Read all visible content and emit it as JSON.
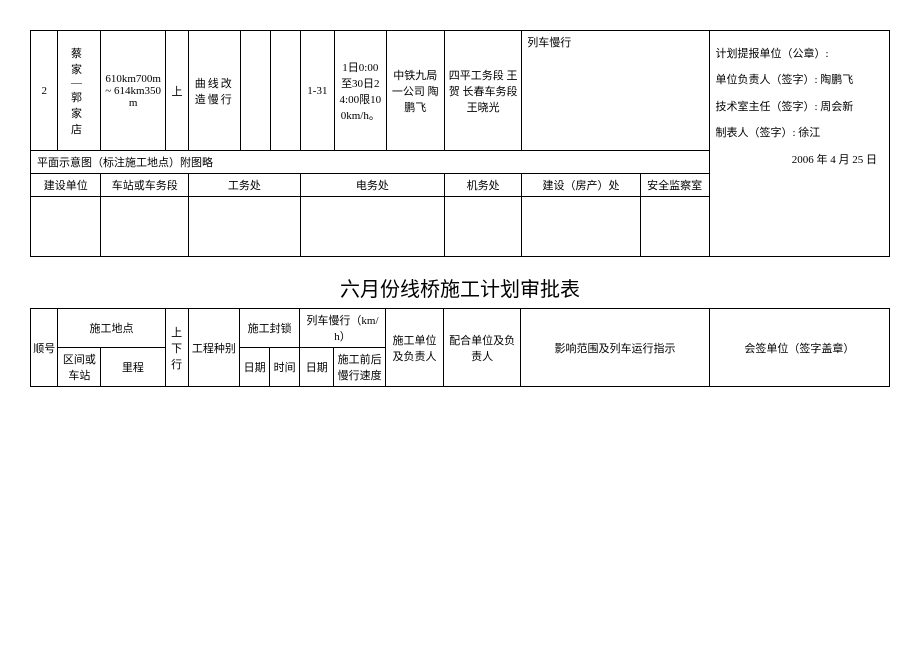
{
  "table1": {
    "row": {
      "num": "2",
      "station": "蔡 家 — 郭 家 店",
      "mileage": "610km700m ~ 614km350m",
      "ud": "上",
      "project_type": "曲线改造慢行",
      "seal_date": "",
      "seal_time": "",
      "slow_date": "1-31",
      "slow_speed": "1日0:00至30日24:00限100km/h。",
      "unit_person": "中铁九局一公司 陶鹏飞",
      "coop_person": "四平工务段 王贺 长春车务段 王晓光",
      "influence_label": "列车慢行",
      "signoff": ""
    },
    "caption": "平面示意图（标注施工地点）附图略",
    "departments": {
      "d1": "建设单位",
      "d2": "车站或车务段",
      "d3": "工务处",
      "d4": "电务处",
      "d5": "机务处",
      "d6": "建设（房产）处",
      "d7": "安全监察室"
    },
    "sigs": {
      "plan_unit": "计划提报单位（公章）:",
      "unit_head": "单位负责人（签字）: 陶鹏飞",
      "tech_head": "技术室主任（签字）: 周会新",
      "form_author": "制表人（签字）: 徐江",
      "date": "2006 年 4 月 25 日"
    }
  },
  "title": "六月份线桥施工计划审批表",
  "table2": {
    "h": {
      "num": "顺号",
      "loc": "施工地点",
      "loc_station": "区间或车站",
      "loc_mileage": "里程",
      "ud": "上下行",
      "type": "工程种别",
      "seal": "施工封锁",
      "slow": "列车慢行（km/h）",
      "date": "日期",
      "time": "时间",
      "slow_date": "日期",
      "slow_speed": "施工前后慢行速度",
      "unit": "施工单位及负责人",
      "coop": "配合单位及负责人",
      "influence": "影响范围及列车运行指示",
      "signoff": "会签单位（签字盖章）"
    }
  }
}
